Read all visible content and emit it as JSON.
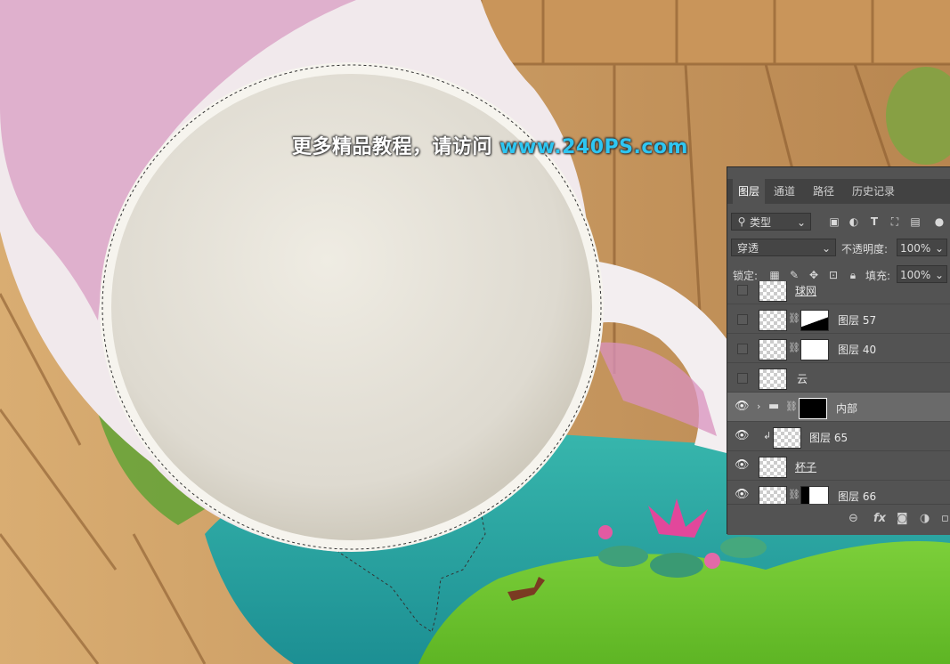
{
  "watermark": {
    "text": "更多精品教程，请访问 ",
    "url": "www.240PS.com"
  },
  "panel": {
    "tabs": [
      "图层",
      "通道",
      "路径",
      "历史记录"
    ],
    "filter_kind": "类型",
    "blend_mode": "穿透",
    "opacity_label": "不透明度:",
    "opacity_value": "100%",
    "lock_label": "锁定:",
    "fill_label": "填充:",
    "fill_value": "100%",
    "layers": [
      {
        "name": "球网",
        "visible": false
      },
      {
        "name": "图层 57",
        "visible": false
      },
      {
        "name": "图层 40",
        "visible": false
      },
      {
        "name": "云",
        "visible": false
      },
      {
        "name": "内部",
        "visible": true
      },
      {
        "name": "图层 65",
        "visible": true
      },
      {
        "name": "杯子",
        "visible": true
      },
      {
        "name": "图层 66",
        "visible": true
      }
    ]
  },
  "icons": [
    "eye-icon",
    "search-icon",
    "image-filter-icon",
    "adjustment-filter-icon",
    "type-filter-icon",
    "shape-filter-icon",
    "smart-object-filter-icon",
    "lock-pixels-icon",
    "lock-brush-icon",
    "lock-position-icon",
    "lock-artboard-icon",
    "lock-all-icon",
    "folder-icon",
    "link-icon",
    "fx-icon",
    "mask-icon",
    "new-layer-icon",
    "delete-icon"
  ]
}
